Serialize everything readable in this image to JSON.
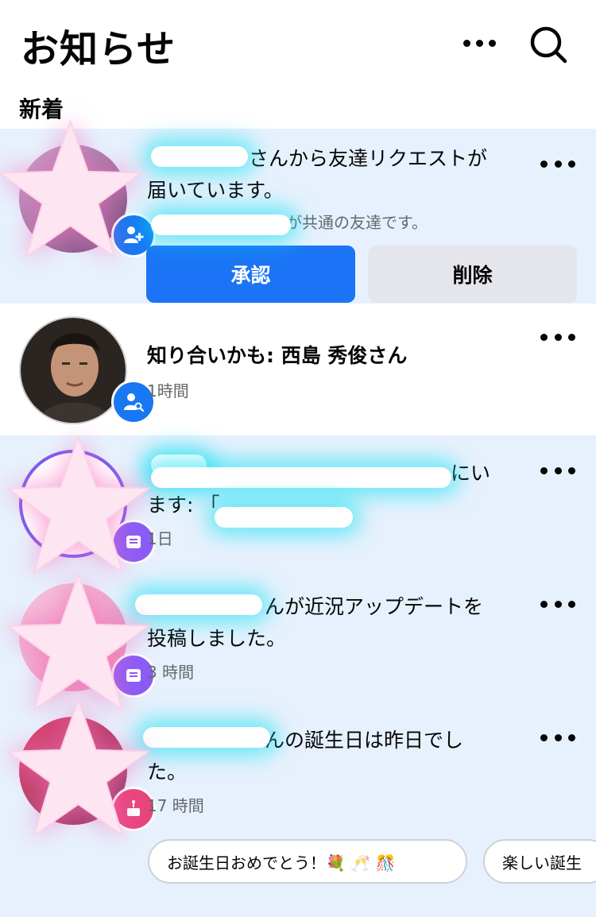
{
  "header": {
    "title": "お知らせ",
    "more_icon": "more-dots-icon",
    "search_icon": "search-icon"
  },
  "section": {
    "label": "新着"
  },
  "notifications": [
    {
      "text_visible": "さんから友達リクエストが届いています。",
      "text_line1": "さんから友達リクエストが",
      "text_line2": "届いています。",
      "mutual": "が共通の友達です。",
      "badge_icon": "add-friend-icon",
      "actions": {
        "confirm": "承認",
        "delete": "削除"
      },
      "state": "unread"
    },
    {
      "text": "知り合いかも: 西島 秀俊さん",
      "time": "1時間",
      "badge_icon": "people-search-icon",
      "state": "read"
    },
    {
      "text_line1_tail": "にい",
      "text_line2_head": "ます: 「",
      "time": "1日",
      "badge_icon": "group-post-icon",
      "state": "unread"
    },
    {
      "text_line1": "んが近況アップデートを",
      "text_line2": "投稿しました。",
      "time": "3 時間",
      "badge_icon": "post-icon",
      "state": "unread"
    },
    {
      "text_line1": "んの誕生日は昨日でし",
      "text_line2": "た。",
      "time": "17 時間",
      "badge_icon": "birthday-cake-icon",
      "state": "unread",
      "quick_replies": [
        "お誕生日おめでとう！💐 🥂 🎊",
        "楽しい誕生"
      ]
    }
  ],
  "colors": {
    "primary": "#1b74f5",
    "unread_bg": "#e7f1fd",
    "secondary_btn": "#e4e6eb",
    "muted_text": "#65676b"
  }
}
